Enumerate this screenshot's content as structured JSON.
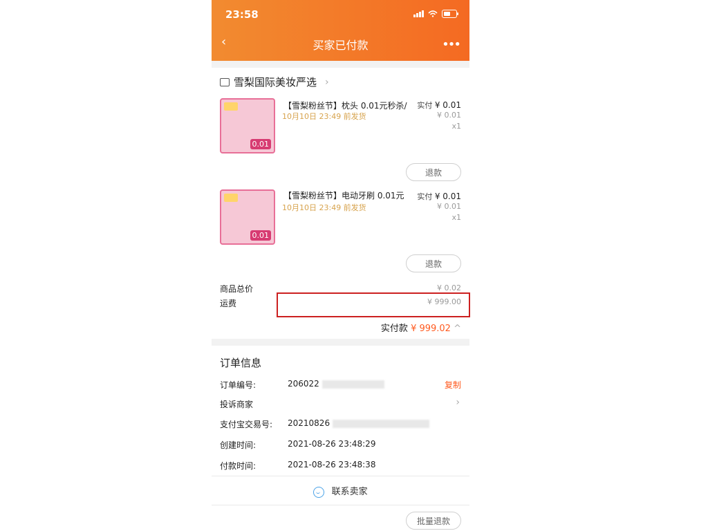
{
  "statusbar": {
    "time": "23:58"
  },
  "header": {
    "title": "买家已付款",
    "back_icon": "chevron-left-icon",
    "more_icon": "more-icon"
  },
  "shop": {
    "name": "雪梨国际美妆严选"
  },
  "items": [
    {
      "name": "【雪梨粉丝节】枕头 0.01元秒杀/",
      "ship": "10月10日 23:49 前发货",
      "paid_label": "实付",
      "paid_value": "¥ 0.01",
      "orig_value": "¥ 0.01",
      "qty": "x1",
      "refund": "退款",
      "badge": "0.01"
    },
    {
      "name": "【雪梨粉丝节】电动牙刷 0.01元",
      "ship": "10月10日 23:49 前发货",
      "paid_label": "实付",
      "paid_value": "¥ 0.01",
      "orig_value": "¥ 0.01",
      "qty": "x1",
      "refund": "退款",
      "badge": "0.01"
    }
  ],
  "summary": {
    "goods_total_label": "商品总价",
    "goods_total_value": "¥ 0.02",
    "shipping_label": "运费",
    "shipping_value": "¥ 999.00",
    "actual_label": "实付款",
    "actual_value": "¥ 999.02"
  },
  "order": {
    "title": "订单信息",
    "no_label": "订单编号:",
    "no_value": "206022",
    "copy": "复制",
    "complain_label": "投诉商家",
    "alipay_label": "支付宝交易号:",
    "alipay_value": "20210826",
    "created_label": "创建时间:",
    "created_value": "2021-08-26 23:48:29",
    "paid_label": "付款时间:",
    "paid_value": "2021-08-26 23:48:38"
  },
  "footer": {
    "contact": "联系卖家",
    "bulk_refund": "批量退款"
  },
  "colors": {
    "header_start": "#f28b30",
    "header_end": "#f46a22",
    "accent": "#ff5a1f",
    "highlight_box": "#cc2020"
  }
}
